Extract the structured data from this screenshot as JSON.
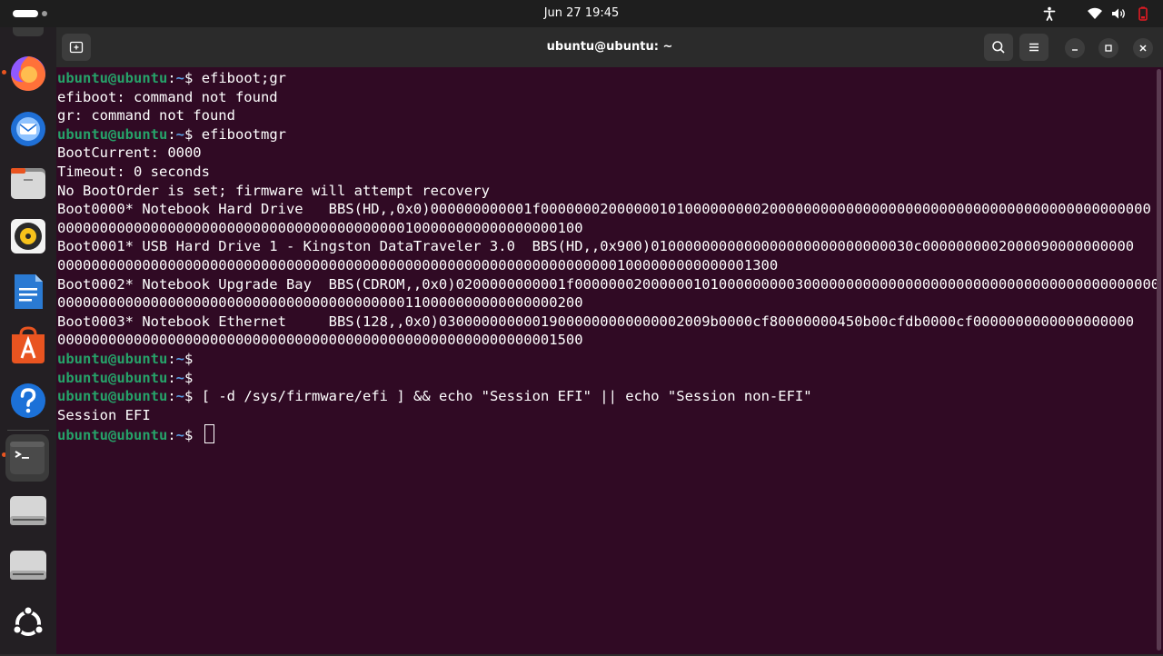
{
  "top_bar": {
    "clock": "Jun 27  19:45",
    "icons": [
      "accessibility-icon",
      "wifi-icon",
      "volume-icon",
      "battery-icon"
    ]
  },
  "dock": {
    "items": [
      {
        "name": "firefox-icon",
        "running": true
      },
      {
        "name": "thunderbird-icon",
        "running": false
      },
      {
        "name": "files-icon",
        "running": false
      },
      {
        "name": "rhythmbox-icon",
        "running": false
      },
      {
        "name": "writer-icon",
        "running": false
      },
      {
        "name": "app-center-icon",
        "running": false
      },
      {
        "name": "help-icon",
        "running": false
      },
      {
        "name": "terminal-icon",
        "running": true,
        "active": true
      },
      {
        "name": "drive-icon",
        "running": false
      },
      {
        "name": "drive-icon",
        "running": false
      },
      {
        "name": "show-apps-icon",
        "running": false
      }
    ]
  },
  "window": {
    "title": "ubuntu@ubuntu: ~",
    "new_tab_icon": "new-tab-icon",
    "search_icon": "search-icon",
    "menu_icon": "hamburger-menu-icon"
  },
  "terminal": {
    "prompt_user": "ubuntu@ubuntu",
    "prompt_sep": ":",
    "prompt_path": "~",
    "prompt_end": "$ ",
    "lines": [
      {
        "type": "prompt",
        "text": "efiboot;gr"
      },
      {
        "type": "out",
        "text": "efiboot: command not found"
      },
      {
        "type": "out",
        "text": "gr: command not found"
      },
      {
        "type": "prompt",
        "text": "efibootmgr"
      },
      {
        "type": "out",
        "text": "BootCurrent: 0000"
      },
      {
        "type": "out",
        "text": "Timeout: 0 seconds"
      },
      {
        "type": "out",
        "text": "No BootOrder is set; firmware will attempt recovery"
      },
      {
        "type": "out",
        "text": "Boot0000* Notebook Hard Drive   BBS(HD,,0x0)000000000001f000000020000001010000000002000000000000000000000000000000000000000000000"
      },
      {
        "type": "out",
        "text": "00000000000000000000000000000000000000000100000000000000000100"
      },
      {
        "type": "out",
        "text": "Boot0001* USB Hard Drive 1 - Kingston DataTraveler 3.0  BBS(HD,,0x900)0100000000000000000000000000030c0000000002000090000000000"
      },
      {
        "type": "out",
        "text": "0000000000000000000000000000000000000000000000000000000000000000001000000000000001300"
      },
      {
        "type": "out",
        "text": "Boot0002* Notebook Upgrade Bay  BBS(CDROM,,0x0)0200000000001f000000020000001010000000003000000000000000000000000000000000000000000"
      },
      {
        "type": "out",
        "text": "00000000000000000000000000000000000000000110000000000000000200"
      },
      {
        "type": "out",
        "text": "Boot0003* Notebook Ethernet     BBS(128,,0x0)03000000000019000000000000002009b0000cf80000000450b00cfdb0000cf0000000000000000000"
      },
      {
        "type": "out",
        "text": "00000000000000000000000000000000000000000000000000000000001500"
      },
      {
        "type": "prompt",
        "text": ""
      },
      {
        "type": "prompt",
        "text": ""
      },
      {
        "type": "prompt",
        "text": "[ -d /sys/firmware/efi ] && echo \"Session EFI\" || echo \"Session non-EFI\""
      },
      {
        "type": "out",
        "text": "Session EFI"
      },
      {
        "type": "prompt",
        "text": "",
        "cursor": true
      }
    ]
  },
  "colors": {
    "terminal_bg": "#300a24",
    "prompt_user": "#26a269",
    "prompt_path": "#5aa0e6",
    "accent": "#e95420"
  }
}
